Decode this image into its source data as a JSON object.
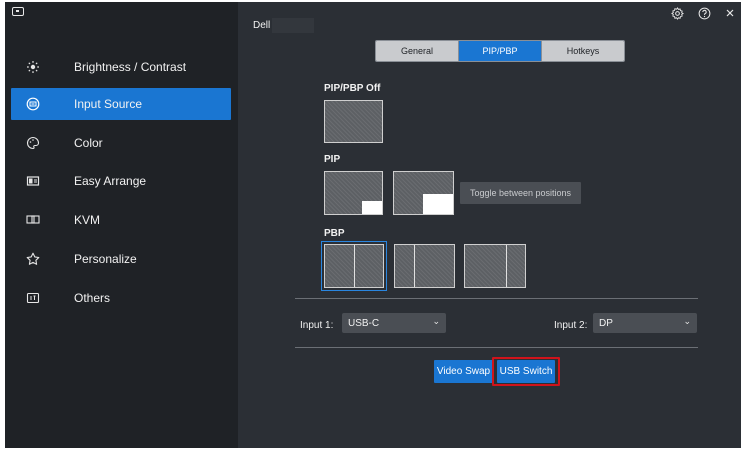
{
  "app": {
    "device_name": "Dell"
  },
  "sidebar": {
    "items": [
      {
        "label": "Brightness / Contrast",
        "icon": "sun-icon",
        "active": false
      },
      {
        "label": "Input Source",
        "icon": "input-source-icon",
        "active": true
      },
      {
        "label": "Color",
        "icon": "palette-icon",
        "active": false
      },
      {
        "label": "Easy Arrange",
        "icon": "layout-icon",
        "active": false
      },
      {
        "label": "KVM",
        "icon": "kvm-icon",
        "active": false
      },
      {
        "label": "Personalize",
        "icon": "star-icon",
        "active": false
      },
      {
        "label": "Others",
        "icon": "others-icon",
        "active": false
      }
    ]
  },
  "titlebar": {
    "settings_icon": "gear-icon",
    "help_icon": "help-icon",
    "close_icon": "close-icon"
  },
  "tabs": [
    {
      "label": "General",
      "active": false
    },
    {
      "label": "PIP/PBP",
      "active": true
    },
    {
      "label": "Hotkeys",
      "active": false
    }
  ],
  "sections": {
    "pip_pbp_off": "PIP/PBP Off",
    "pip": "PIP",
    "pbp": "PBP"
  },
  "toggle_button": "Toggle between positions",
  "inputs": {
    "input1_label": "Input 1:",
    "input1_value": "USB-C",
    "input2_label": "Input 2:",
    "input2_value": "DP"
  },
  "actions": {
    "video_swap": "Video Swap",
    "usb_switch": "USB Switch"
  },
  "colors": {
    "accent": "#1a76d2",
    "highlight": "#d0131b",
    "sidebar_bg": "#1f2226",
    "main_bg": "#2b2f35"
  }
}
